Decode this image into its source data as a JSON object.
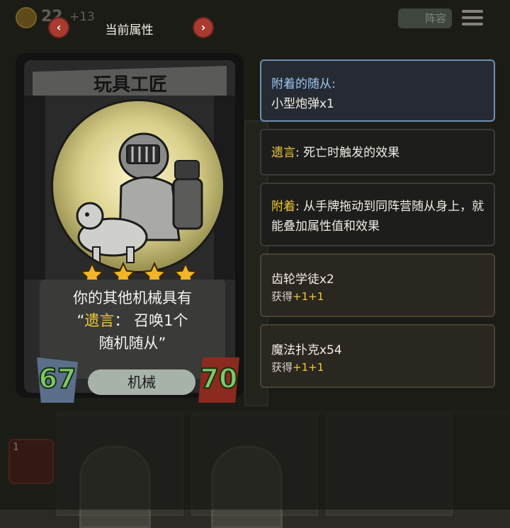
{
  "topbar": {
    "gold": "22",
    "gold_income": "+13",
    "title": "当前属性",
    "prev_icon": "‹",
    "next_icon": "›",
    "lineup_label": "阵容"
  },
  "card": {
    "name": "玩具工匠",
    "stars": 4,
    "desc_line1": "你的其他机械具有",
    "desc_quote_open": "“",
    "desc_keyword": "遗言",
    "desc_line2_rest": "： 召唤1个",
    "desc_line3": "随机随从”",
    "tribe": "机械",
    "attack": "67",
    "health": "70"
  },
  "info": {
    "attached_title": "附着的随从:",
    "attached_item": "小型炮弹x1",
    "deathrattle_kw": "遗言",
    "deathrattle_text": ": 死亡时触发的效果",
    "attach_kw": "附着",
    "attach_text": ": 从手牌拖动到同阵营随从身上，就能叠加属性值和效果"
  },
  "minions": [
    {
      "name": "齿轮学徒x2",
      "gain_prefix": "获得",
      "gain_value": "+1+1"
    },
    {
      "name": "魔法扑克x54",
      "gain_prefix": "获得",
      "gain_value": "+1+1"
    }
  ],
  "bottom": {
    "tier_badge": "1"
  },
  "colors": {
    "keyword": "#f3c838",
    "stat": "#7ec868",
    "nav_button": "#a93a2f",
    "active_border": "#6e8fb2"
  }
}
